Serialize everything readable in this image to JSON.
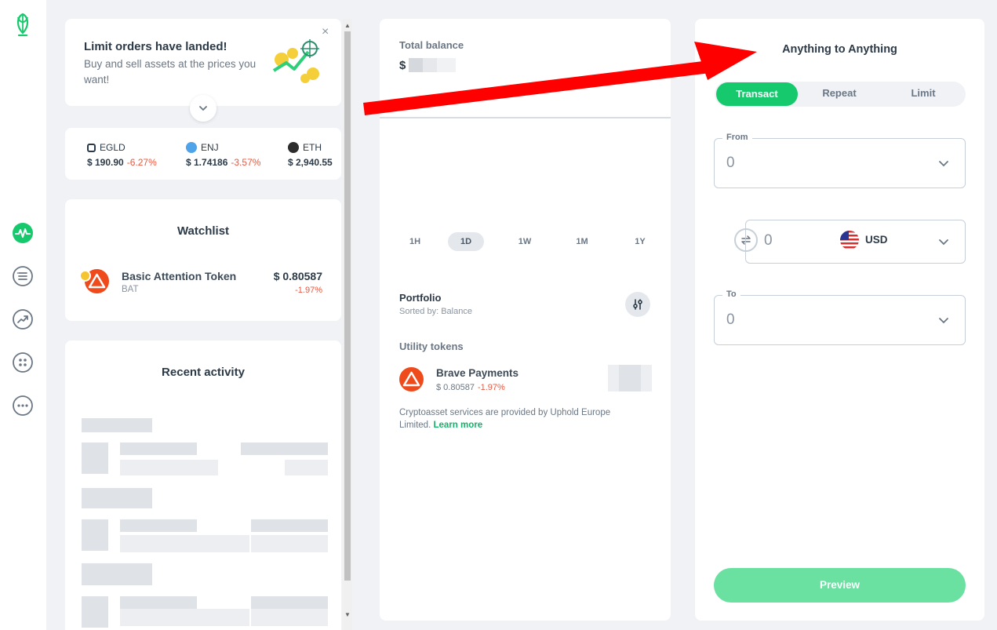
{
  "rail": {
    "icons": [
      "uphold-logo-icon",
      "activity-icon",
      "list-icon",
      "trending-icon",
      "apps-icon",
      "more-icon"
    ]
  },
  "promo": {
    "title": "Limit orders have landed!",
    "text": "Buy and sell assets at the prices you want!",
    "close": "×"
  },
  "ticker": [
    {
      "symbol": "EGLD",
      "price": "$ 190.90",
      "change": "-6.27%",
      "color": "#2c3a47"
    },
    {
      "symbol": "ENJ",
      "price": "$ 1.74186",
      "change": "-3.57%",
      "color": "#4fa3e8"
    },
    {
      "symbol": "ETH",
      "price": "$ 2,940.55",
      "change": "",
      "color": "#2c2c2c"
    }
  ],
  "watchlist": {
    "title": "Watchlist",
    "items": [
      {
        "name": "Basic Attention Token",
        "symbol": "BAT",
        "price": "$ 0.80587",
        "change": "-1.97%"
      }
    ]
  },
  "recent": {
    "title": "Recent activity"
  },
  "balance": {
    "label": "Total balance",
    "currency": "$"
  },
  "ranges": [
    "1H",
    "1D",
    "1W",
    "1M",
    "1Y"
  ],
  "active_range": "1D",
  "portfolio": {
    "title": "Portfolio",
    "sorted": "Sorted by: Balance",
    "group": "Utility tokens",
    "asset_name": "Brave Payments",
    "asset_price": "$ 0.80587",
    "asset_change": "-1.97%",
    "disclaimer": "Cryptoasset services are provided by Uphold Europe Limited.",
    "learn_more": "Learn more"
  },
  "transact": {
    "title": "Anything to Anything",
    "tabs": [
      "Transact",
      "Repeat",
      "Limit"
    ],
    "active_tab": "Transact",
    "from_label": "From",
    "from_value": "0",
    "amount_value": "0",
    "amount_currency": "USD",
    "to_label": "To",
    "to_value": "0",
    "preview": "Preview"
  },
  "colors": {
    "accent": "#17c96d",
    "negative": "#e9573f",
    "annotation": "#ff0000"
  }
}
